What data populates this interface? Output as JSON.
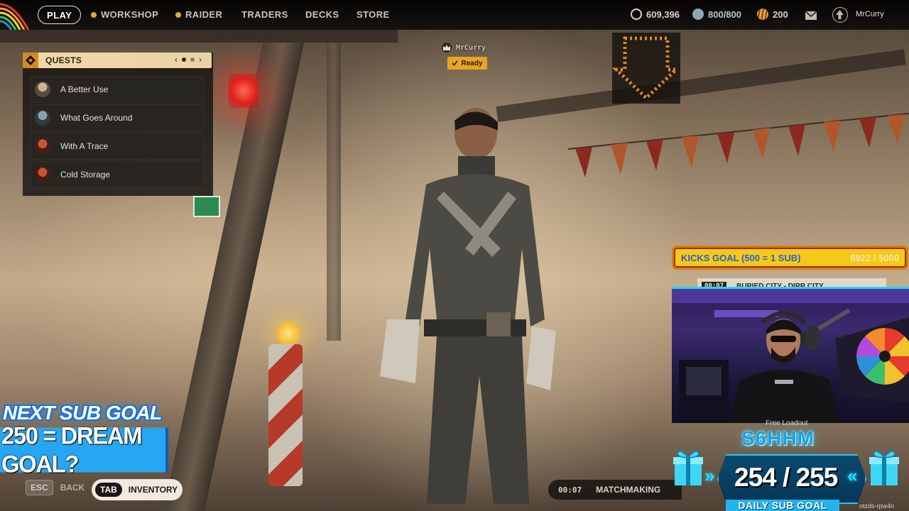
{
  "nav": {
    "play": "PLAY",
    "workshop": "WORKSHOP",
    "raider": "RAIDER",
    "traders": "TRADERS",
    "decks": "DECKS",
    "store": "STORE"
  },
  "currencies": {
    "coins": "609,396",
    "raider_tokens": "800/800",
    "credits": "200"
  },
  "user": {
    "name": "MrCurry"
  },
  "quests": {
    "title": "QUESTS",
    "page_prev": "‹",
    "page_next": "›",
    "items": [
      {
        "label": "A Better Use"
      },
      {
        "label": "What Goes Around"
      },
      {
        "label": "With A Trace"
      },
      {
        "label": "Cold Storage"
      }
    ]
  },
  "player_tag": {
    "name": "MrCurry",
    "status": "Ready"
  },
  "overlay_left": {
    "next_sub_goal": "NEXT SUB GOAL",
    "dream_goal": "250 = DREAM GOAL?"
  },
  "hints": {
    "esc_key": "ESC",
    "back": "BACK",
    "tab_key": "TAB",
    "inventory": "INVENTORY"
  },
  "matchmaking": {
    "timer": "00:07",
    "label": "MATCHMAKING"
  },
  "overlay_right": {
    "kicks_goal_label": "KICKS GOAL (500 = 1 SUB)",
    "kicks_goal_progress": "6922 / 5000",
    "queue_timer": "00:07",
    "queue_text": "BURIED CITY - DIRR CITY",
    "free_loadout": "Free Loadout",
    "sub_code": "S6HHM",
    "sub_count": "254 / 255",
    "daily_sub_goal": "DAILY SUB GOAL",
    "stream_code": "otzds-rpw4n",
    "arrow_left": "»",
    "arrow_right": "«"
  },
  "icons": {
    "coin": "coin-icon",
    "token": "token-icon",
    "credit": "credit-icon",
    "mail": "mail-icon",
    "rank": "rank-icon",
    "quest_marker": "quest-marker-icon",
    "crown": "crown-icon",
    "check": "check-icon",
    "gift": "gift-icon"
  },
  "colors": {
    "accent_orange": "#e9a423",
    "quest_header": "#f2d9a6",
    "sub_goal_blue": "#27a6f2",
    "kicks_yellow": "#f6c81a",
    "cyan": "#22d8ef"
  }
}
